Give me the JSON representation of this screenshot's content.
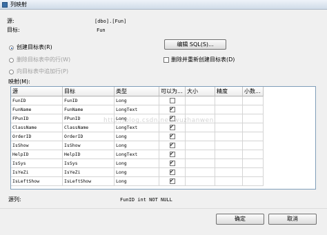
{
  "window": {
    "title": "列映射"
  },
  "source": {
    "label": "源:",
    "value": "[dbo].[Fun]"
  },
  "target": {
    "label": "目标:",
    "value": "Fun"
  },
  "options": {
    "create": "创建目标表(R)",
    "delete_rows": "删除目标表中的行(W)",
    "append_rows": "向目标表中追加行(P)",
    "edit_sql": "编辑 SQL(S)...",
    "drop_recreate": "删除并重新创建目标表(D)"
  },
  "mapping": {
    "label": "映射(M):",
    "headers": [
      "源",
      "目标",
      "类型",
      "可以为...",
      "大小",
      "精度",
      "小数..."
    ],
    "rows": [
      [
        "FunID",
        "FunID",
        "Long",
        false
      ],
      [
        "FunName",
        "FunName",
        "LongText",
        true
      ],
      [
        "FPunID",
        "FPunID",
        "Long",
        true
      ],
      [
        "ClassName",
        "ClassName",
        "LongText",
        true
      ],
      [
        "OrderID",
        "OrderID",
        "Long",
        true
      ],
      [
        "IsShow",
        "IsShow",
        "Long",
        true
      ],
      [
        "HelpID",
        "HelpID",
        "LongText",
        true
      ],
      [
        "IsSys",
        "IsSys",
        "Long",
        true
      ],
      [
        "IsYeZi",
        "IsYeZi",
        "Long",
        true
      ],
      [
        "IsLeftShow",
        "IsLeftShow",
        "Long",
        true
      ]
    ]
  },
  "watermark": "http://blog.csdn.net/wuzhanwen",
  "source_column": {
    "label": "源列:",
    "value": "FunID int NOT NULL"
  },
  "buttons": {
    "ok": "确定",
    "cancel": "取消"
  }
}
